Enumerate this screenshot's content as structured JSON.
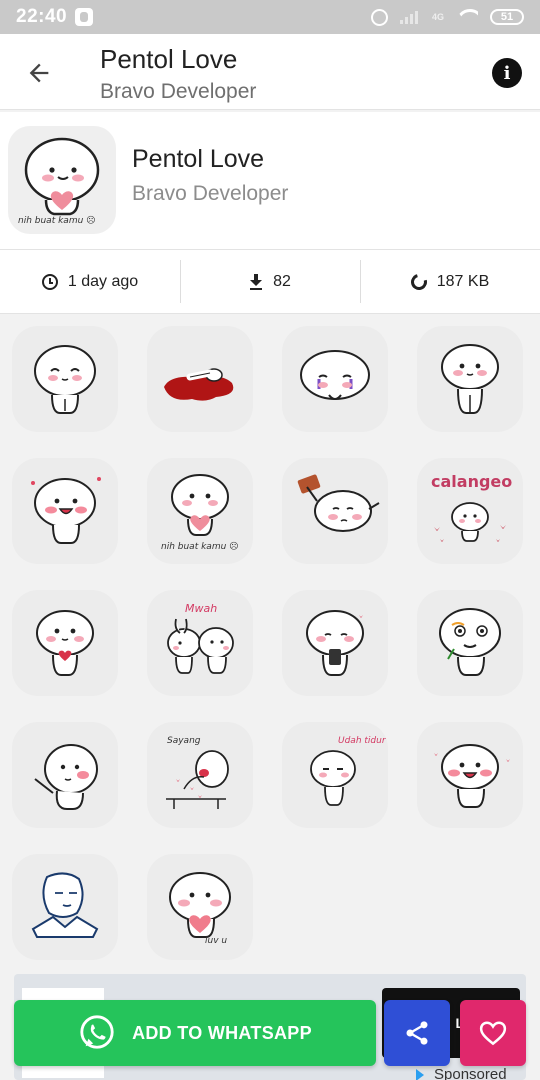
{
  "status_bar": {
    "time": "22:40",
    "network": "4G",
    "battery": "51"
  },
  "app_bar": {
    "title": "Pentol Love",
    "subtitle": "Bravo Developer",
    "back_icon": "arrow-left-icon",
    "info_icon": "info-icon"
  },
  "pack": {
    "title": "Pentol Love",
    "publisher": "Bravo Developer",
    "tray_caption": "nih buat kamu ☹"
  },
  "stats": {
    "updated": "1 day ago",
    "downloads": "82",
    "size": "187 KB"
  },
  "stickers": {
    "s6_caption": "nih buat kamu ☹",
    "s8_caption": "calangeo",
    "s10_caption": "Mwah",
    "s14_caption": "Sayang",
    "s15_caption": "Udah tidur",
    "s18_caption": "luv u"
  },
  "ad": {
    "sponsored": "Sponsored",
    "cta_fragment": "L"
  },
  "actions": {
    "add_label": "ADD TO WHATSAPP",
    "share_icon": "share-icon",
    "favorite_icon": "heart-icon"
  },
  "colors": {
    "whatsapp_green": "#25c45b",
    "share_blue": "#2f4fd6",
    "favorite_pink": "#e0286c"
  }
}
